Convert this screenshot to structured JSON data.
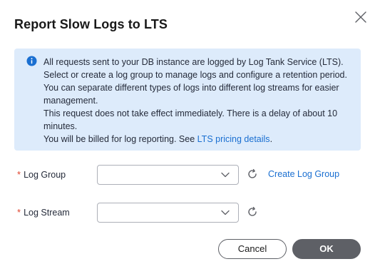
{
  "dialog": {
    "title": "Report Slow Logs to LTS",
    "close_icon": "close-icon"
  },
  "info": {
    "icon": "info-circle-icon",
    "line1": "All requests sent to your DB instance are logged by Log Tank Service (LTS). Select or create a log group to manage logs and configure a retention period. You can separate different types of logs into different log streams for easier management.",
    "line2": "This request does not take effect immediately. There is a delay of about 10 minutes.",
    "line3_prefix": "You will be billed for log reporting. See ",
    "line3_link": "LTS pricing details",
    "line3_suffix": "."
  },
  "form": {
    "log_group": {
      "label": "Log Group",
      "required_mark": "*",
      "value": "",
      "refresh_icon": "refresh-icon",
      "create_link": "Create Log Group"
    },
    "log_stream": {
      "label": "Log Stream",
      "required_mark": "*",
      "value": "",
      "refresh_icon": "refresh-icon"
    }
  },
  "footer": {
    "cancel_label": "Cancel",
    "ok_label": "OK"
  },
  "colors": {
    "info_bg": "#ddebfb",
    "link": "#1a6fd1",
    "required": "#e0432d",
    "primary_button": "#5e6066"
  }
}
